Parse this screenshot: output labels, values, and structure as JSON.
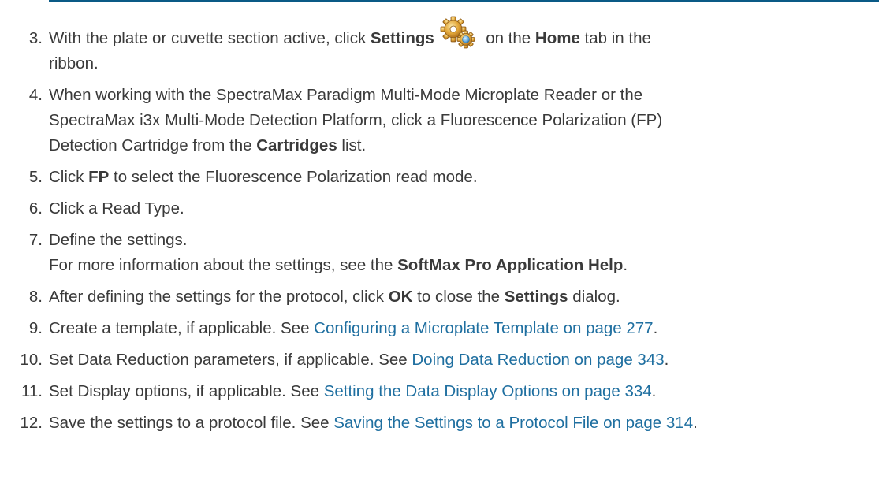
{
  "steps": [
    {
      "num": "3.",
      "t1": "With the plate or cuvette section active, click ",
      "b1": "Settings",
      "t2": " on the ",
      "b2": "Home",
      "t3": " tab in the",
      "line2": "ribbon."
    },
    {
      "num": "4.",
      "line1": "When working with the SpectraMax Paradigm Multi-Mode Microplate Reader or the",
      "line2": "SpectraMax i3x Multi-Mode Detection Platform, click a Fluorescence Polarization (FP)",
      "t3": "Detection Cartridge from the ",
      "b3": "Cartridges",
      "t4": " list."
    },
    {
      "num": "5.",
      "t1": "Click ",
      "b1": "FP",
      "t2": " to select the Fluorescence Polarization read mode."
    },
    {
      "num": "6.",
      "t1": "Click a Read Type."
    },
    {
      "num": "7.",
      "t1": "Define the settings.",
      "sub1": "For more information about the settings, see the ",
      "subb": "SoftMax Pro Application Help",
      "sub2": "."
    },
    {
      "num": "8.",
      "t1": "After defining the settings for the protocol, click ",
      "b1": "OK",
      "t2": " to close the ",
      "b2": "Settings",
      "t3": " dialog."
    },
    {
      "num": "9.",
      "t1": "Create a template, if applicable. See ",
      "link": "Configuring a Microplate Template on page 277",
      "t2": "."
    },
    {
      "num": "10.",
      "t1": "Set Data Reduction parameters, if applicable. See ",
      "link": "Doing Data Reduction on page 343",
      "t2": "."
    },
    {
      "num": "11.",
      "t1": "Set Display options, if applicable. See ",
      "link": "Setting the Data Display Options on page 334",
      "t2": "."
    },
    {
      "num": "12.",
      "t1": "Save the settings to a protocol file. See ",
      "link": "Saving the Settings to a Protocol File on page 314",
      "t2": "."
    }
  ],
  "icons": {
    "settings": "gears-icon"
  },
  "colors": {
    "rule": "#0a5a86",
    "link": "#1f6fa0",
    "text": "#3a3a3a"
  }
}
